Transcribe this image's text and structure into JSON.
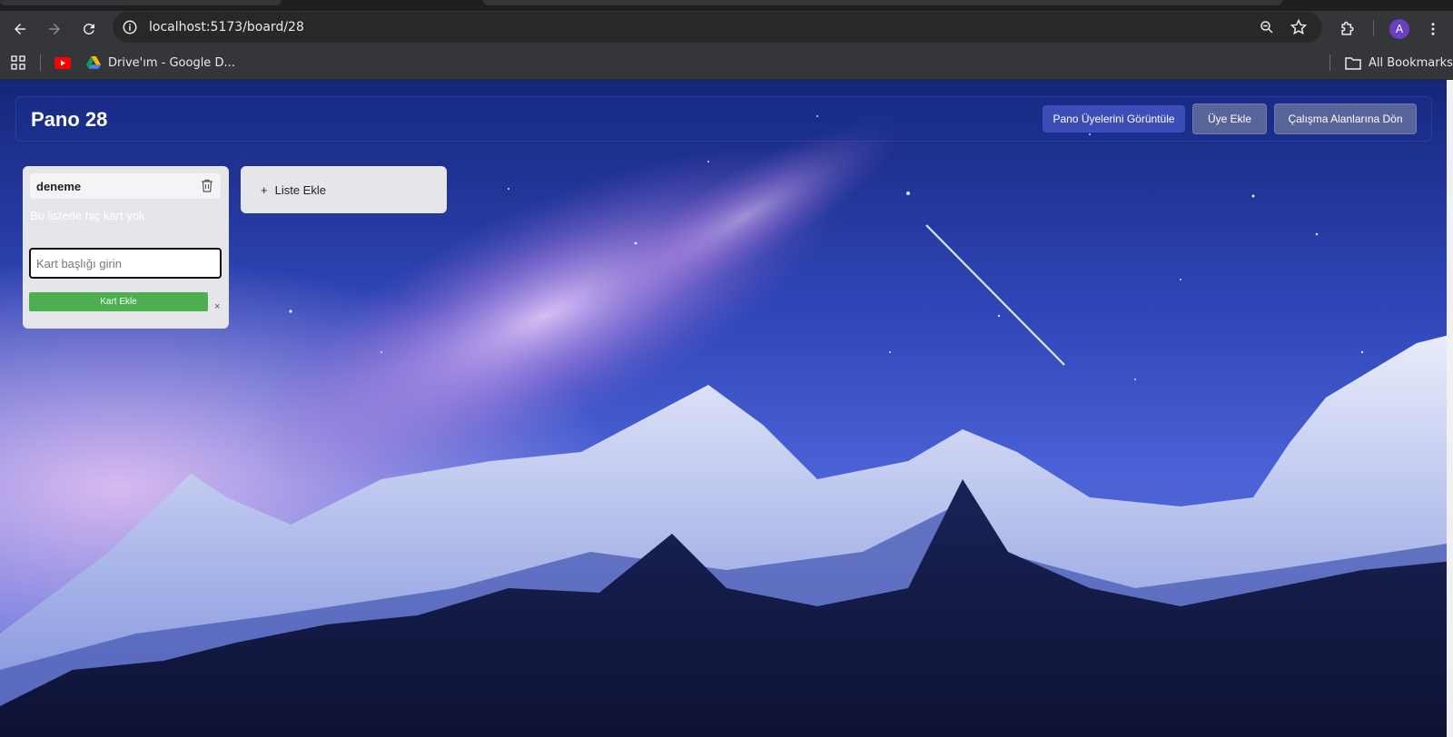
{
  "browser": {
    "url": "localhost:5173/board/28",
    "avatar_letter": "A",
    "bookmarks": [
      {
        "label": "Drive'ım - Google D...",
        "icon": "google-drive-icon"
      }
    ],
    "all_bookmarks_label": "All Bookmarks"
  },
  "board": {
    "title": "Pano 28",
    "buttons": {
      "view_members": "Pano Üyelerini Görüntüle",
      "add_member": "Üye Ekle",
      "back_to_workspaces": "Çalışma Alanlarına Dön"
    }
  },
  "lists": [
    {
      "title": "deneme",
      "empty_text": "Bu listede hiç kart yok",
      "card_input_placeholder": "Kart başlığı girin",
      "add_card_label": "Kart Ekle",
      "close_label": "×"
    }
  ],
  "add_list": {
    "plus": "+",
    "label": "Liste Ekle"
  },
  "colors": {
    "primary_button": "#3d4db7",
    "add_card_button": "#4caf50"
  }
}
